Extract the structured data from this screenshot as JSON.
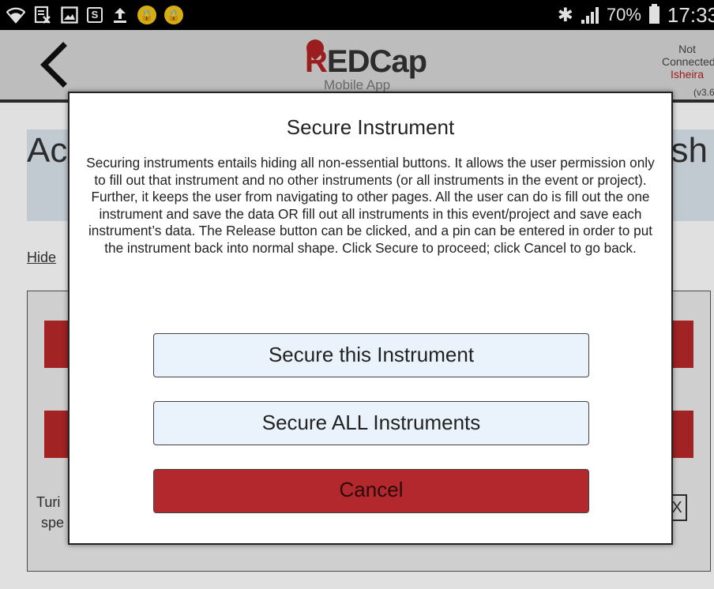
{
  "status_bar": {
    "battery": "70%",
    "time": "17:33",
    "icons": [
      "wifi-question-icon",
      "document-x-icon",
      "image-icon",
      "s-app-icon",
      "upload-icon",
      "lock-icon",
      "lock-icon",
      "bluetooth-icon",
      "signal-icon",
      "battery-icon"
    ]
  },
  "header": {
    "back_icon": "chevron-left-icon",
    "logo_main": "REDCap",
    "logo_sub": "Mobile App",
    "connection_status": "Not Connected",
    "user": "Isheira",
    "version": "(v3.6."
  },
  "background": {
    "title_partial_left": "Ac",
    "title_partial_right": "sh",
    "link_partial": "Hide",
    "text_partial_line1": "Turi",
    "text_partial_line2": "spe",
    "box_partial": "X"
  },
  "dialog": {
    "title": "Secure Instrument",
    "body": "Securing instruments entails hiding all non-essential buttons. It allows the user permission only to fill out that instrument and no other instruments (or all instruments in the event or project). Further, it keeps the user from navigating to other pages. All the user can do is fill out the one instrument and save the data OR fill out all instruments in this event/project and save each instrument’s data. The Release button can be clicked, and a pin can be entered in order to put the instrument back into normal shape. Click Secure to proceed; click Cancel to go back.",
    "secure_this_label": "Secure this Instrument",
    "secure_all_label": "Secure ALL Instruments",
    "cancel_label": "Cancel"
  },
  "colors": {
    "accent_red": "#b3282d",
    "button_light": "#eaf3fb",
    "title_band": "#dde6ee"
  }
}
